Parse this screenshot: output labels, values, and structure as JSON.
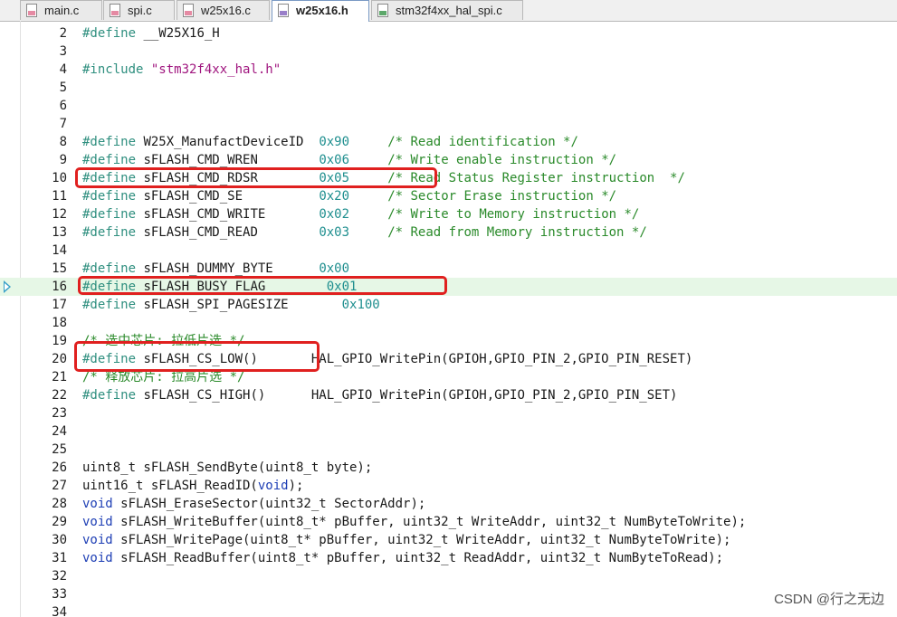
{
  "tabs": [
    {
      "label": "main.c",
      "icon": "c-file-icon",
      "active": false
    },
    {
      "label": "spi.c",
      "icon": "c-file-icon",
      "active": false
    },
    {
      "label": "w25x16.c",
      "icon": "c-file-icon",
      "active": false
    },
    {
      "label": "w25x16.h",
      "icon": "h-file-icon",
      "active": true
    },
    {
      "label": "stm32f4xx_hal_spi.c",
      "icon": "c-file-icon",
      "active": false
    }
  ],
  "colors": {
    "preprocessor": "#2f8f7f",
    "comment": "#2a8a2a",
    "string": "#a0167f",
    "keyword": "#1e3fb5",
    "highlight_box": "#e0201f",
    "current_line": "#e6f7e6"
  },
  "lines": [
    {
      "n": "2",
      "tokens": [
        [
          "pre",
          "#define"
        ],
        [
          "pl",
          " __W25X16_H"
        ]
      ]
    },
    {
      "n": "3",
      "tokens": []
    },
    {
      "n": "4",
      "tokens": [
        [
          "pre",
          "#include"
        ],
        [
          "pl",
          " "
        ],
        [
          "str",
          "\"stm32f4xx_hal.h\""
        ]
      ]
    },
    {
      "n": "5",
      "tokens": []
    },
    {
      "n": "6",
      "tokens": []
    },
    {
      "n": "7",
      "tokens": []
    },
    {
      "n": "8",
      "tokens": [
        [
          "pre",
          "#define"
        ],
        [
          "pl",
          " W25X_ManufactDeviceID  "
        ],
        [
          "num",
          "0x90"
        ],
        [
          "pl",
          "     "
        ],
        [
          "cm",
          "/* Read identification */"
        ]
      ]
    },
    {
      "n": "9",
      "tokens": [
        [
          "pre",
          "#define"
        ],
        [
          "pl",
          " sFLASH_CMD_WREN        "
        ],
        [
          "num",
          "0x06"
        ],
        [
          "pl",
          "     "
        ],
        [
          "cm",
          "/* Write enable instruction */"
        ]
      ]
    },
    {
      "n": "10",
      "tokens": [
        [
          "pre",
          "#define"
        ],
        [
          "pl",
          " sFLASH_CMD_RDSR        "
        ],
        [
          "num",
          "0x05"
        ],
        [
          "pl",
          "     "
        ],
        [
          "cm",
          "/* Read Status Register instruction  */"
        ]
      ]
    },
    {
      "n": "11",
      "tokens": [
        [
          "pre",
          "#define"
        ],
        [
          "pl",
          " sFLASH_CMD_SE          "
        ],
        [
          "num",
          "0x20"
        ],
        [
          "pl",
          "     "
        ],
        [
          "cm",
          "/* Sector Erase instruction */"
        ]
      ]
    },
    {
      "n": "12",
      "tokens": [
        [
          "pre",
          "#define"
        ],
        [
          "pl",
          " sFLASH_CMD_WRITE       "
        ],
        [
          "num",
          "0x02"
        ],
        [
          "pl",
          "     "
        ],
        [
          "cm",
          "/* Write to Memory instruction */"
        ]
      ]
    },
    {
      "n": "13",
      "tokens": [
        [
          "pre",
          "#define"
        ],
        [
          "pl",
          " sFLASH_CMD_READ        "
        ],
        [
          "num",
          "0x03"
        ],
        [
          "pl",
          "     "
        ],
        [
          "cm",
          "/* Read from Memory instruction */"
        ]
      ]
    },
    {
      "n": "14",
      "tokens": []
    },
    {
      "n": "15",
      "tokens": [
        [
          "pre",
          "#define"
        ],
        [
          "pl",
          " sFLASH_DUMMY_BYTE      "
        ],
        [
          "num",
          "0x00"
        ]
      ]
    },
    {
      "n": "16",
      "tokens": [
        [
          "pre",
          "#define"
        ],
        [
          "pl",
          " sFLASH_BUSY_FLAG        "
        ],
        [
          "num",
          "0x01"
        ]
      ],
      "current": true
    },
    {
      "n": "17",
      "tokens": [
        [
          "pre",
          "#define"
        ],
        [
          "pl",
          " sFLASH_SPI_PAGESIZE       "
        ],
        [
          "num",
          "0x100"
        ]
      ]
    },
    {
      "n": "18",
      "tokens": []
    },
    {
      "n": "19",
      "tokens": [
        [
          "cm",
          "/* 选中芯片: 拉低片选 */"
        ]
      ]
    },
    {
      "n": "20",
      "tokens": [
        [
          "pre",
          "#define"
        ],
        [
          "pl",
          " sFLASH_CS_LOW()       HAL_GPIO_WritePin(GPIOH,GPIO_PIN_2,GPIO_PIN_RESET)"
        ]
      ]
    },
    {
      "n": "21",
      "tokens": [
        [
          "cm",
          "/* 释放芯片: 拉高片选 */"
        ]
      ]
    },
    {
      "n": "22",
      "tokens": [
        [
          "pre",
          "#define"
        ],
        [
          "pl",
          " sFLASH_CS_HIGH()      HAL_GPIO_WritePin(GPIOH,GPIO_PIN_2,GPIO_PIN_SET)"
        ]
      ]
    },
    {
      "n": "23",
      "tokens": []
    },
    {
      "n": "24",
      "tokens": []
    },
    {
      "n": "25",
      "tokens": []
    },
    {
      "n": "26",
      "tokens": [
        [
          "pl",
          "uint8_t sFLASH_SendByte(uint8_t byte);"
        ]
      ]
    },
    {
      "n": "27",
      "tokens": [
        [
          "pl",
          "uint16_t sFLASH_ReadID("
        ],
        [
          "kw",
          "void"
        ],
        [
          "pl",
          ");"
        ]
      ]
    },
    {
      "n": "28",
      "tokens": [
        [
          "kw",
          "void"
        ],
        [
          "pl",
          " sFLASH_EraseSector(uint32_t SectorAddr);"
        ]
      ]
    },
    {
      "n": "29",
      "tokens": [
        [
          "kw",
          "void"
        ],
        [
          "pl",
          " sFLASH_WriteBuffer(uint8_t* pBuffer, uint32_t WriteAddr, uint32_t NumByteToWrite);"
        ]
      ]
    },
    {
      "n": "30",
      "tokens": [
        [
          "kw",
          "void"
        ],
        [
          "pl",
          " sFLASH_WritePage(uint8_t* pBuffer, uint32_t WriteAddr, uint32_t NumByteToWrite);"
        ]
      ]
    },
    {
      "n": "31",
      "tokens": [
        [
          "kw",
          "void"
        ],
        [
          "pl",
          " sFLASH_ReadBuffer(uint8_t* pBuffer, uint32_t ReadAddr, uint32_t NumByteToRead);"
        ]
      ]
    },
    {
      "n": "32",
      "tokens": []
    },
    {
      "n": "33",
      "tokens": []
    },
    {
      "n": "34",
      "tokens": []
    }
  ],
  "watermark": "CSDN @行之无边"
}
